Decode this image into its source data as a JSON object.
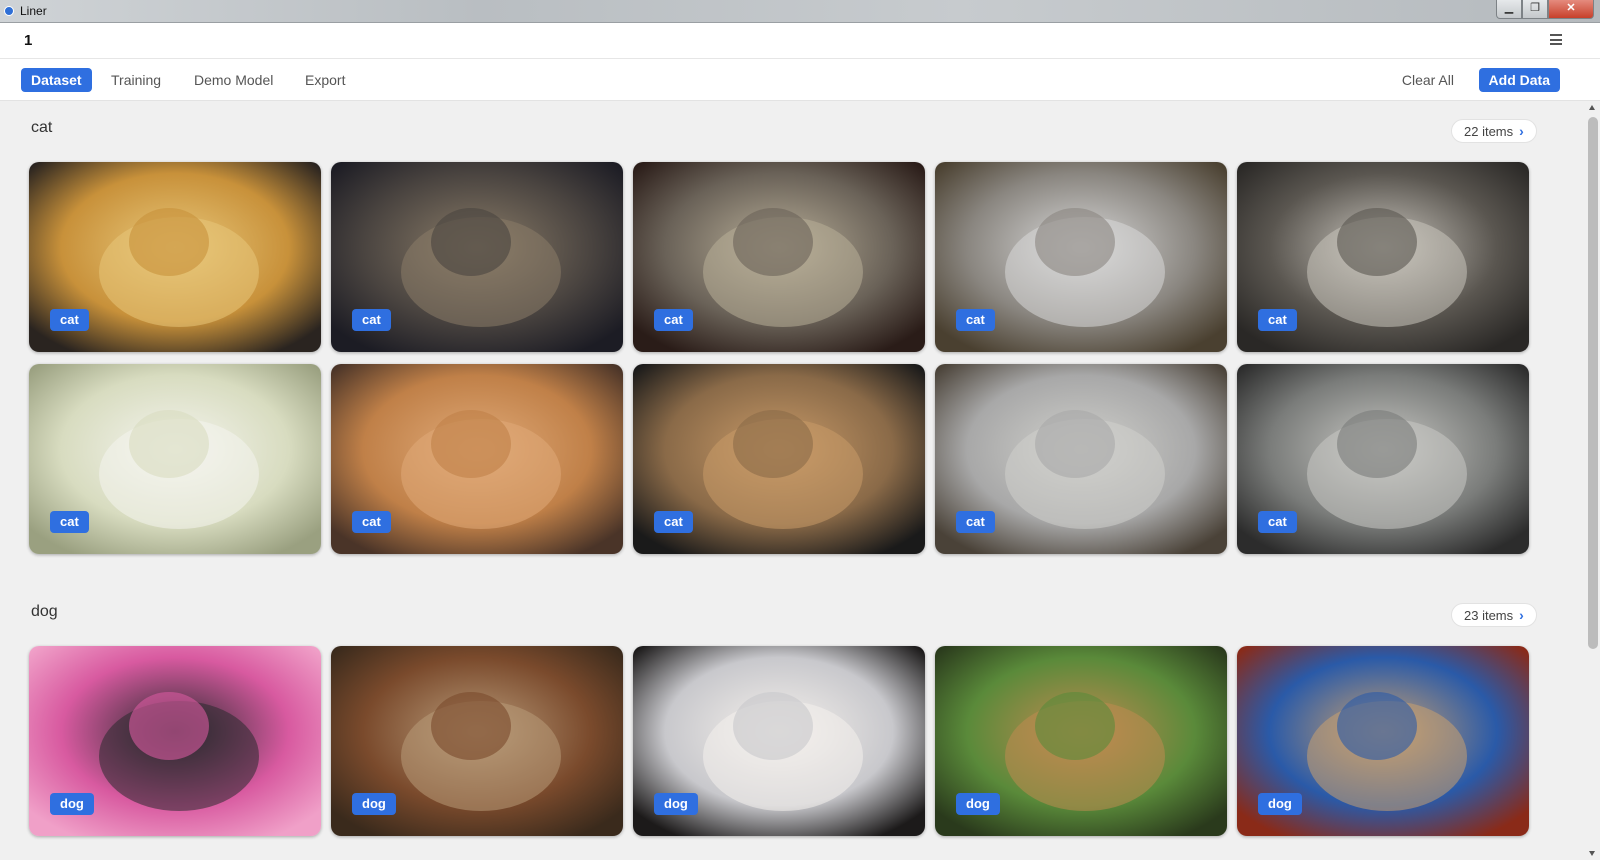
{
  "window": {
    "title": "Liner",
    "minimize": "▁",
    "maximize": "❐",
    "close": "✕"
  },
  "app": {
    "project_name": "1"
  },
  "tabs": [
    {
      "label": "Dataset",
      "active": true
    },
    {
      "label": "Training",
      "active": false
    },
    {
      "label": "Demo Model",
      "active": false
    },
    {
      "label": "Export",
      "active": false
    }
  ],
  "toolbar": {
    "clear_all": "Clear All",
    "add_data": "Add Data"
  },
  "accent_color": "#2f6fe0",
  "sections": [
    {
      "name": "cat",
      "items_label": "22 items",
      "images": [
        {
          "label": "cat",
          "palette": [
            "#c8913a",
            "#e8c77a",
            "#2a2420"
          ]
        },
        {
          "label": "cat",
          "palette": [
            "#4a4440",
            "#8a7c68",
            "#1c1c24"
          ]
        },
        {
          "label": "cat",
          "palette": [
            "#6a6258",
            "#b8ae98",
            "#2a1c18"
          ]
        },
        {
          "label": "cat",
          "palette": [
            "#8a8680",
            "#d8d8d8",
            "#4a4030"
          ]
        },
        {
          "label": "cat",
          "palette": [
            "#5a5650",
            "#c8c4bc",
            "#2a2826"
          ]
        },
        {
          "label": "cat",
          "palette": [
            "#d8dcc0",
            "#f4f4ee",
            "#9aa080"
          ]
        },
        {
          "label": "cat",
          "palette": [
            "#c08048",
            "#e0aa78",
            "#4a3428"
          ]
        },
        {
          "label": "cat",
          "palette": [
            "#8a6a48",
            "#c89a68",
            "#1a1a1a"
          ]
        },
        {
          "label": "cat",
          "palette": [
            "#a8a8a8",
            "#d0d0cc",
            "#4a4238"
          ]
        },
        {
          "label": "cat",
          "palette": [
            "#7a7c7a",
            "#c8c8c4",
            "#2c2c2c"
          ]
        }
      ]
    },
    {
      "name": "dog",
      "items_label": "23 items",
      "images": [
        {
          "label": "dog",
          "palette": [
            "#d85aa0",
            "#2a2a2e",
            "#f0a0c8"
          ]
        },
        {
          "label": "dog",
          "palette": [
            "#7a4a2c",
            "#b89a78",
            "#3a2a1c"
          ]
        },
        {
          "label": "dog",
          "palette": [
            "#c8c8cc",
            "#f4f0ec",
            "#1c1a1a"
          ]
        },
        {
          "label": "dog",
          "palette": [
            "#5a8a3a",
            "#c08a50",
            "#2a3a1c"
          ]
        },
        {
          "label": "dog",
          "palette": [
            "#2a5aa8",
            "#c8a070",
            "#8a2a18"
          ]
        }
      ]
    }
  ]
}
